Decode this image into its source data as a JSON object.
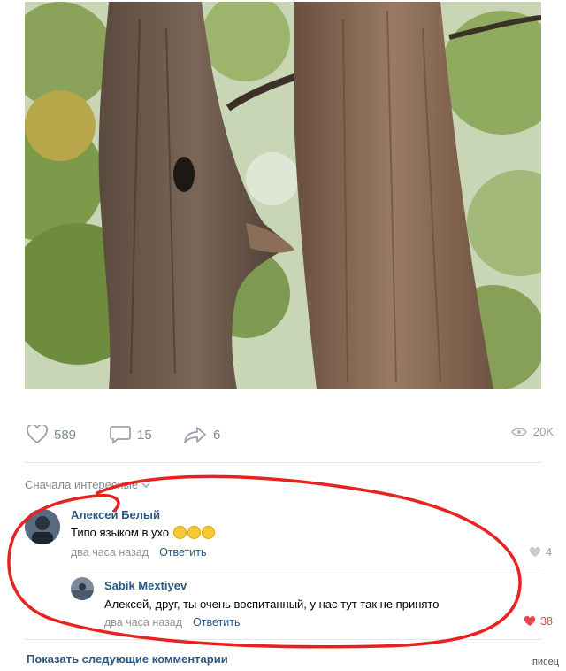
{
  "post": {
    "photo": {
      "subject": "tree-ear-photo"
    },
    "likes": "589",
    "comments": "15",
    "shares": "6",
    "views": "20K"
  },
  "comments_section": {
    "sort_label": "Сначала интересные",
    "comments": [
      {
        "author": "Алексей Белый",
        "text": "Типо языком в ухо",
        "time": "два часа назад",
        "reply_label": "Ответить",
        "likes": "4"
      },
      {
        "author": "Sabik Mextiyev",
        "text": "Алексей, друг, ты очень воспитанный, у нас тут так не принято",
        "time": "два часа назад",
        "reply_label": "Ответить",
        "likes": "38"
      }
    ],
    "show_more_label": "Показать следующие комментарии"
  },
  "watermark": "писец",
  "colors": {
    "link": "#2a5885",
    "meta": "#939393",
    "like_active": "#e64646",
    "annotation": "#e8231f"
  }
}
